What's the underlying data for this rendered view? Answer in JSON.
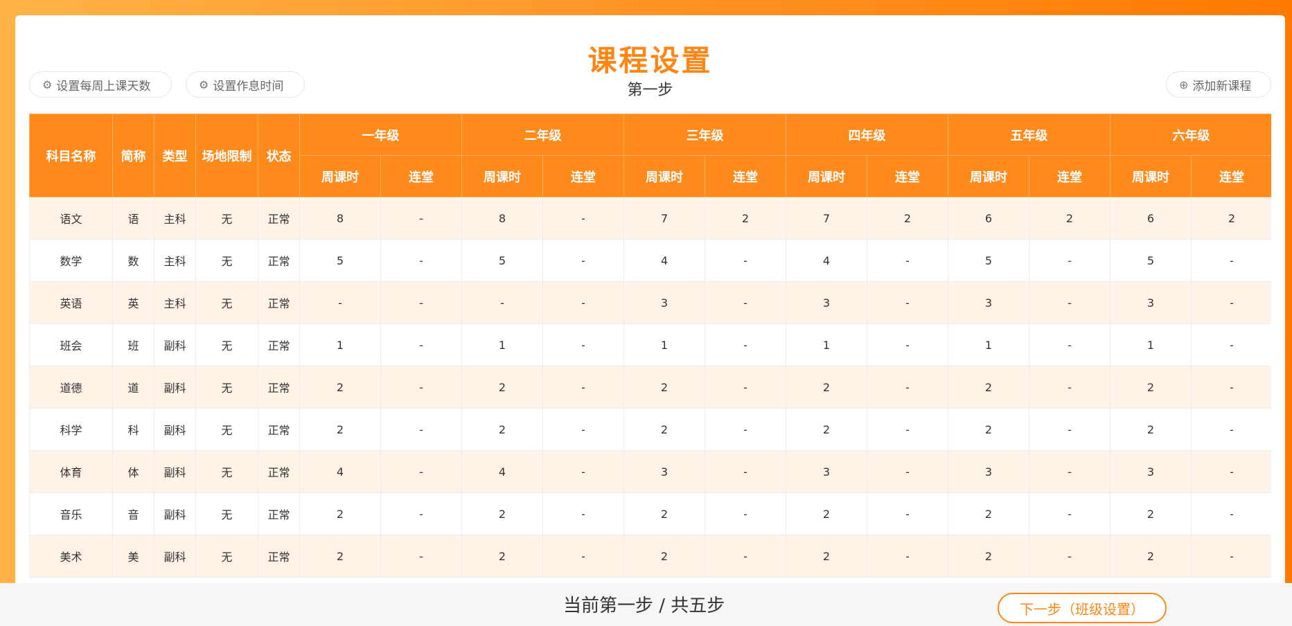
{
  "title": "课程设置",
  "subtitle": "第一步",
  "toolbar": {
    "set_days_label": "设置每周上课天数",
    "set_rest_label": "设置作息时间",
    "add_course_label": "添加新课程"
  },
  "colors": {
    "accent": "#ff8514",
    "header_bg": "#ff8a1c",
    "stripe": "#fff2e6"
  },
  "table": {
    "columns": {
      "name": "科目名称",
      "short": "简称",
      "type": "类型",
      "venue": "场地限制",
      "status": "状态",
      "grades": [
        "一年级",
        "二年级",
        "三年级",
        "四年级",
        "五年级",
        "六年级"
      ],
      "weekly": "周课时",
      "consecutive": "连堂"
    },
    "rows": [
      [
        "语文",
        "语",
        "主科",
        "无",
        "正常",
        "8",
        "-",
        "8",
        "-",
        "7",
        "2",
        "7",
        "2",
        "6",
        "2",
        "6",
        "2"
      ],
      [
        "数学",
        "数",
        "主科",
        "无",
        "正常",
        "5",
        "-",
        "5",
        "-",
        "4",
        "-",
        "4",
        "-",
        "5",
        "-",
        "5",
        "-"
      ],
      [
        "英语",
        "英",
        "主科",
        "无",
        "正常",
        "-",
        "-",
        "-",
        "-",
        "3",
        "-",
        "3",
        "-",
        "3",
        "-",
        "3",
        "-"
      ],
      [
        "班会",
        "班",
        "副科",
        "无",
        "正常",
        "1",
        "-",
        "1",
        "-",
        "1",
        "-",
        "1",
        "-",
        "1",
        "-",
        "1",
        "-"
      ],
      [
        "道德",
        "道",
        "副科",
        "无",
        "正常",
        "2",
        "-",
        "2",
        "-",
        "2",
        "-",
        "2",
        "-",
        "2",
        "-",
        "2",
        "-"
      ],
      [
        "科学",
        "科",
        "副科",
        "无",
        "正常",
        "2",
        "-",
        "2",
        "-",
        "2",
        "-",
        "2",
        "-",
        "2",
        "-",
        "2",
        "-"
      ],
      [
        "体育",
        "体",
        "副科",
        "无",
        "正常",
        "4",
        "-",
        "4",
        "-",
        "3",
        "-",
        "3",
        "-",
        "3",
        "-",
        "3",
        "-"
      ],
      [
        "音乐",
        "音",
        "副科",
        "无",
        "正常",
        "2",
        "-",
        "2",
        "-",
        "2",
        "-",
        "2",
        "-",
        "2",
        "-",
        "2",
        "-"
      ],
      [
        "美术",
        "美",
        "副科",
        "无",
        "正常",
        "2",
        "-",
        "2",
        "-",
        "2",
        "-",
        "2",
        "-",
        "2",
        "-",
        "2",
        "-"
      ]
    ]
  },
  "footer": {
    "step_text": "当前第一步 / 共五步",
    "next_label": "下一步（班级设置）"
  }
}
